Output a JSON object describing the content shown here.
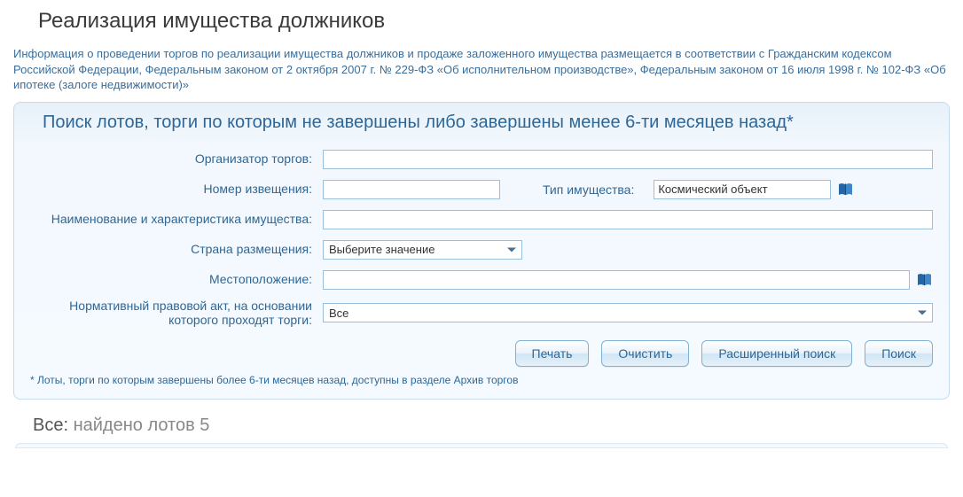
{
  "page_title": "Реализация имущества должников",
  "info": "Информация о проведении торгов по реализации имущества должников и продаже заложенного имущества размещается в соответствии с Гражданским кодексом Российской Федерации, Федеральным законом от 2 октября 2007 г. № 229-ФЗ «Об исполнительном производстве», Федеральным законом от 16 июля 1998 г. № 102-ФЗ «Об ипотеке (залоге недвижимости)»",
  "panel_title": "Поиск лотов, торги по которым не завершены либо завершены менее 6-ти месяцев назад*",
  "labels": {
    "organizer": "Организатор торгов:",
    "notice_number": "Номер извещения:",
    "property_type": "Тип имущества:",
    "property_name": "Наименование и характеристика имущества:",
    "country": "Страна размещения:",
    "location": "Местоположение:",
    "legal_act": "Нормативный правовой акт, на основании которого проходят торги:"
  },
  "values": {
    "organizer": "",
    "notice_number": "",
    "property_type": "Космический объект",
    "property_name": "",
    "country": "Выберите значение",
    "location": "",
    "legal_act": "Все"
  },
  "buttons": {
    "print": "Печать",
    "clear": "Очистить",
    "advanced": "Расширенный поиск",
    "search": "Поиск"
  },
  "footnote": "* Лоты, торги по которым завершены более 6-ти месяцев назад, доступны в разделе Архив торгов",
  "results": {
    "label": "Все:",
    "found_prefix": "найдено лотов",
    "count": "5"
  }
}
